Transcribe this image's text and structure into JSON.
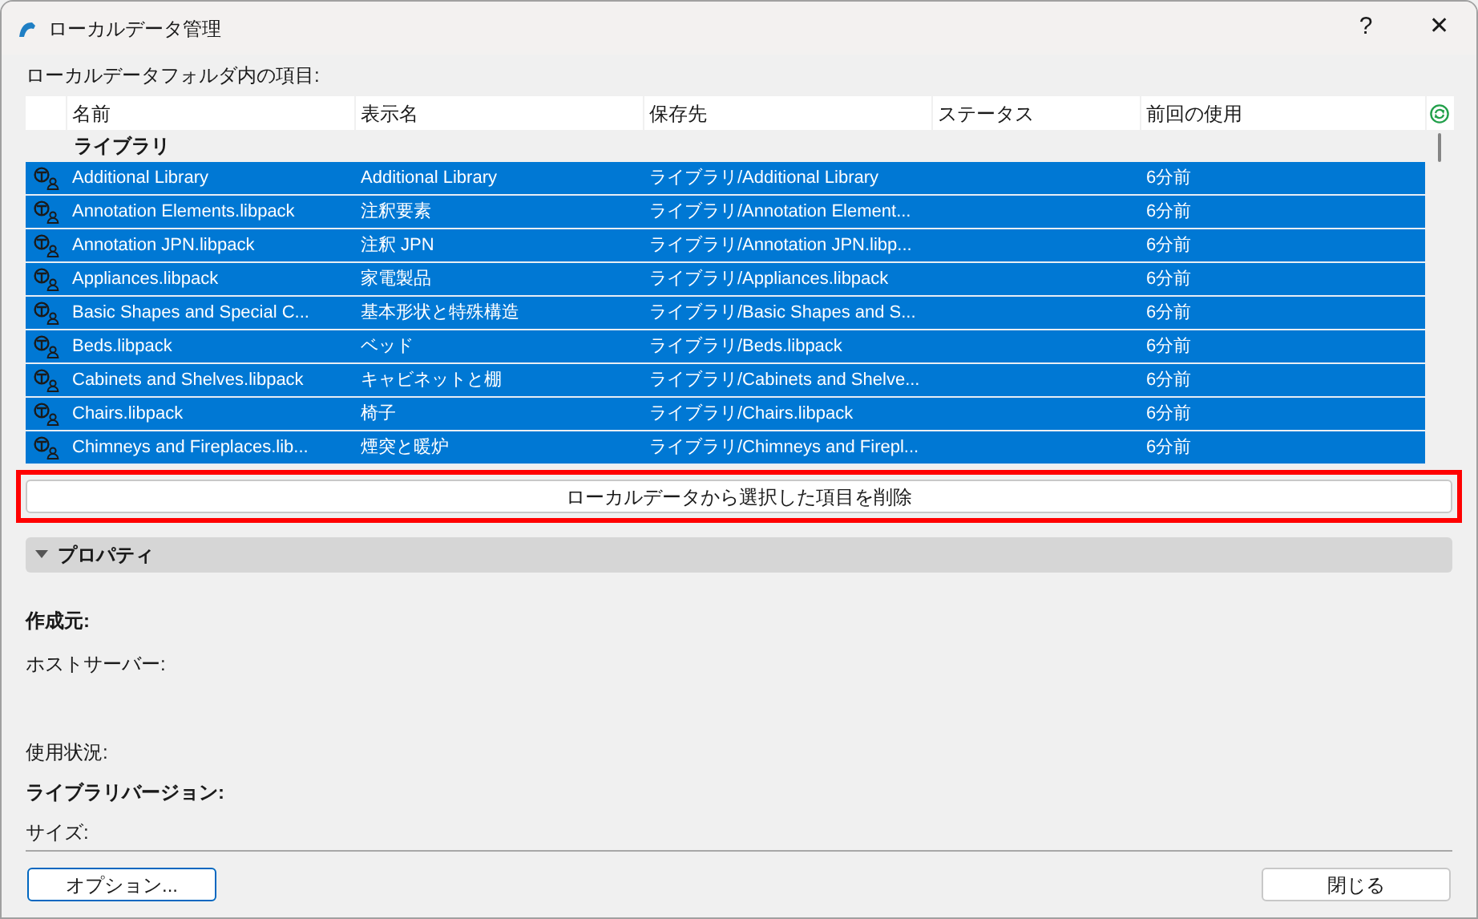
{
  "window": {
    "title": "ローカルデータ管理",
    "buttons": [
      "?",
      "✕"
    ]
  },
  "list_label": "ローカルデータフォルダ内の項目:",
  "table": {
    "columns": [
      "名前",
      "表示名",
      "保存先",
      "ステータス",
      "前回の使用"
    ],
    "group": "ライブラリ",
    "rows": [
      {
        "name": "Additional Library",
        "display": "Additional Library",
        "location": "ライブラリ/Additional Library",
        "status": "",
        "last_used": "6分前",
        "selected": true
      },
      {
        "name": "Annotation Elements.libpack",
        "display": "注釈要素",
        "location": "ライブラリ/Annotation Element...",
        "last_used": "6分前",
        "selected": true
      },
      {
        "name": "Annotation JPN.libpack",
        "display": "注釈 JPN",
        "location": "ライブラリ/Annotation JPN.libp...",
        "last_used": "6分前",
        "selected": true
      },
      {
        "name": "Appliances.libpack",
        "display": "家電製品",
        "location": "ライブラリ/Appliances.libpack",
        "last_used": "6分前",
        "selected": true
      },
      {
        "name": "Basic Shapes and Special C...",
        "display": "基本形状と特殊構造",
        "location": "ライブラリ/Basic Shapes and S...",
        "last_used": "6分前",
        "selected": true
      },
      {
        "name": "Beds.libpack",
        "display": "ベッド",
        "location": "ライブラリ/Beds.libpack",
        "last_used": "6分前",
        "selected": true
      },
      {
        "name": "Cabinets and Shelves.libpack",
        "display": "キャビネットと棚",
        "location": "ライブラリ/Cabinets and Shelve...",
        "last_used": "6分前",
        "selected": true
      },
      {
        "name": "Chairs.libpack",
        "display": "椅子",
        "location": "ライブラリ/Chairs.libpack",
        "last_used": "6分前",
        "selected": true
      },
      {
        "name": "Chimneys and Fireplaces.lib...",
        "display": "煙突と暖炉",
        "location": "ライブラリ/Chimneys and Firepl...",
        "last_used": "6分前",
        "selected": true
      }
    ]
  },
  "delete_button": {
    "label": "ローカルデータから選択した項目を削除",
    "highlighted": true
  },
  "properties": {
    "title": "プロパティ",
    "expanded": true,
    "fields": [
      {
        "label": "作成元:",
        "bold": true
      },
      {
        "label": "ホストサーバー:",
        "bold": false
      },
      {
        "label": "使用状況:",
        "bold": false
      },
      {
        "label": "ライブラリバージョン:",
        "bold": true
      },
      {
        "label": "サイズ:",
        "bold": false
      }
    ]
  },
  "footer": {
    "options_button": "オプション...",
    "close_button": "閉じる"
  }
}
